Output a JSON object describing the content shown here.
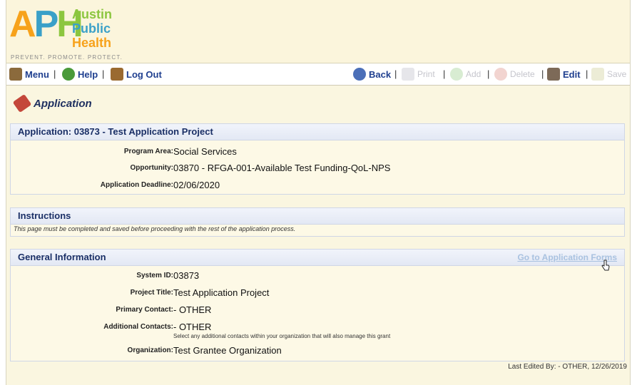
{
  "logo": {
    "letters": [
      "A",
      "P",
      "H"
    ],
    "words": [
      "Austin",
      "Public",
      "Health"
    ],
    "tagline": "PREVENT. PROMOTE. PROTECT."
  },
  "toolbar": {
    "left": [
      {
        "label": "Menu",
        "icon": "menu-icon"
      },
      {
        "label": "Help",
        "icon": "help-icon"
      },
      {
        "label": "Log Out",
        "icon": "logout-icon"
      }
    ],
    "right": [
      {
        "label": "Back",
        "icon": "back-arrow-icon",
        "enabled": true
      },
      {
        "label": "Print",
        "icon": "print-icon",
        "enabled": false
      },
      {
        "label": "Add",
        "icon": "add-icon",
        "enabled": false
      },
      {
        "label": "Delete",
        "icon": "delete-icon",
        "enabled": false
      },
      {
        "label": "Edit",
        "icon": "edit-icon",
        "enabled": true
      },
      {
        "label": "Save",
        "icon": "save-icon",
        "enabled": false
      }
    ],
    "separator": "|"
  },
  "page": {
    "title": "Application"
  },
  "application": {
    "header": "Application: 03873 - Test Application Project",
    "fields": [
      {
        "label": "Program Area:",
        "value": "Social Services"
      },
      {
        "label": "Opportunity:",
        "value": "03870 - RFGA-001-Available Test Funding-QoL-NPS"
      },
      {
        "label": "Application Deadline:",
        "value": "02/06/2020"
      }
    ]
  },
  "instructions": {
    "header": "Instructions",
    "text": "This page must be completed and saved before proceeding with the rest of the application process."
  },
  "general": {
    "header": "General Information",
    "link": "Go to Application Forms",
    "fields": [
      {
        "label": "System ID:",
        "value": "03873"
      },
      {
        "label": "Project Title:",
        "value": "Test Application Project"
      },
      {
        "label": "Primary Contact:",
        "value": "- OTHER"
      },
      {
        "label": "Additional Contacts:",
        "value": "- OTHER",
        "hint": "Select any additional contacts within your organization that will also manage this grant"
      },
      {
        "label": "Organization:",
        "value": "Test Grantee Organization"
      }
    ]
  },
  "footer": {
    "last_edited": "Last Edited By: - OTHER, 12/26/2019"
  },
  "colors": {
    "accent": "#1f3f8f",
    "link_disabled": "#a9c2e0",
    "panel_bg": "#fdf9e6"
  }
}
